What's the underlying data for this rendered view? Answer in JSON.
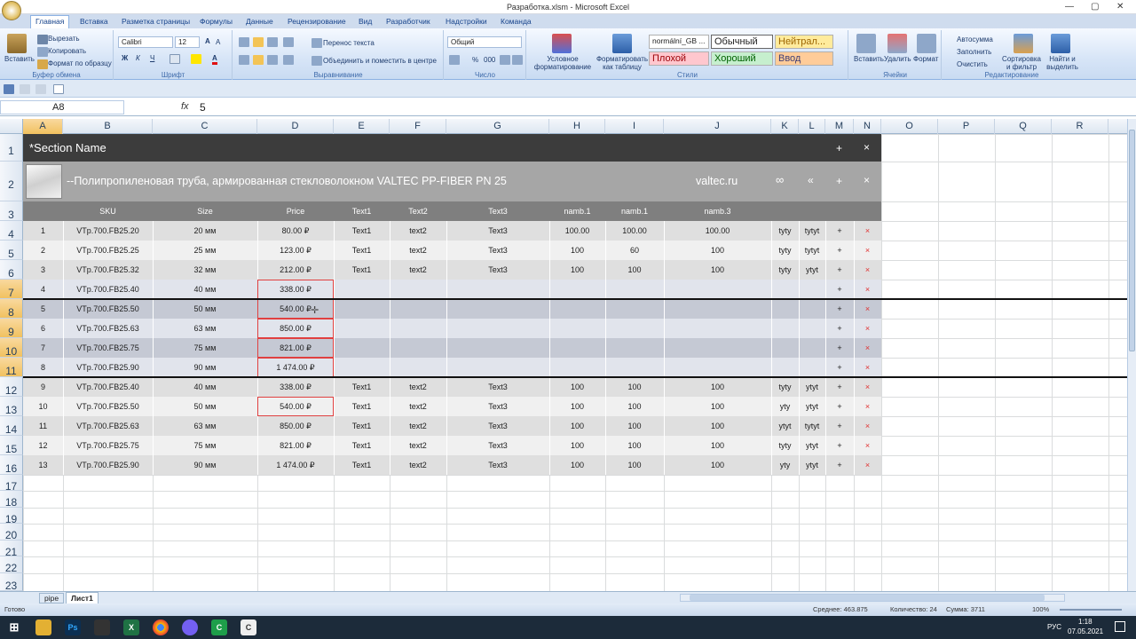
{
  "window": {
    "title": "Разработка.xlsm - Microsoft Excel"
  },
  "tabs": [
    "Главная",
    "Вставка",
    "Разметка страницы",
    "Формулы",
    "Данные",
    "Рецензирование",
    "Вид",
    "Разработчик",
    "Надстройки",
    "Команда"
  ],
  "ribbon": {
    "clipboard": {
      "paste": "Вставить",
      "cut": "Вырезать",
      "copy": "Копировать",
      "format_painter": "Формат по образцу",
      "label": "Буфер обмена"
    },
    "font": {
      "name": "Calibri",
      "size": "12",
      "label": "Шрифт",
      "bold": "Ж",
      "italic": "К",
      "underline": "Ч",
      "color_a": "A"
    },
    "alignment": {
      "wrap": "Перенос текста",
      "merge": "Объединить и поместить в центре",
      "label": "Выравнивание"
    },
    "number": {
      "format": "Общий",
      "label": "Число",
      "percent": "%",
      "thousands": "000"
    },
    "styles": {
      "cond": "Условное форматирование",
      "table": "Форматировать как таблицу",
      "cells": [
        "normální_GB ...",
        "Обычный",
        "Нейтрал...",
        "Плохой",
        "Хороший",
        "Ввод"
      ],
      "label": "Стили"
    },
    "cells": {
      "insert": "Вставить",
      "delete": "Удалить",
      "format": "Формат",
      "label": "Ячейки"
    },
    "editing": {
      "autosum": "Автосумма",
      "fill": "Заполнить",
      "clear": "Очистить",
      "sort": "Сортировка и фильтр",
      "find": "Найти и выделить",
      "label": "Редактирование"
    }
  },
  "formula_bar": {
    "name_box": "A8",
    "fx": "fx",
    "value": "5"
  },
  "columns": [
    "A",
    "B",
    "C",
    "D",
    "E",
    "F",
    "G",
    "H",
    "I",
    "J",
    "K",
    "L",
    "M",
    "N",
    "O",
    "P",
    "Q",
    "R"
  ],
  "row_numbers": [
    "1",
    "2",
    "3",
    "4",
    "5",
    "6",
    "7",
    "8",
    "9",
    "10",
    "11",
    "12",
    "13",
    "14",
    "15",
    "16",
    "17",
    "18",
    "19",
    "20",
    "21",
    "22",
    "23"
  ],
  "section": {
    "name": "*Section Name",
    "plus": "+",
    "close": "×"
  },
  "product": {
    "title": "--Полипропиленовая труба, армированная стекловолокном VALTEC PP-FIBER PN 25",
    "brand": "valtec.ru",
    "link": "∞",
    "collapse": "«",
    "plus": "+",
    "close": "×"
  },
  "table_header": [
    "SKU",
    "Size",
    "Price",
    "Text1",
    "Text2",
    "Text3",
    "namb.1",
    "namb.1",
    "namb.3"
  ],
  "rows": [
    {
      "n": "1",
      "sku": "VTp.700.FB25.20",
      "size": "20 мм",
      "price": "80.00 ₽",
      "t1": "Text1",
      "t2": "text2",
      "t3": "Text3",
      "n1": "100.00",
      "n2": "100.00",
      "n3": "100.00",
      "k": "tyty",
      "l": "tytyt",
      "plus": "+",
      "x": "×"
    },
    {
      "n": "2",
      "sku": "VTp.700.FB25.25",
      "size": "25 мм",
      "price": "123.00 ₽",
      "t1": "Text1",
      "t2": "text2",
      "t3": "Text3",
      "n1": "100",
      "n2": "60",
      "n3": "100",
      "k": "tyty",
      "l": "tytyt",
      "plus": "+",
      "x": "×"
    },
    {
      "n": "3",
      "sku": "VTp.700.FB25.32",
      "size": "32 мм",
      "price": "212.00 ₽",
      "t1": "Text1",
      "t2": "text2",
      "t3": "Text3",
      "n1": "100",
      "n2": "100",
      "n3": "100",
      "k": "tyty",
      "l": "ytyt",
      "plus": "+",
      "x": "×"
    },
    {
      "n": "4",
      "sku": "VTp.700.FB25.40",
      "size": "40 мм",
      "price": "338.00 ₽",
      "t1": "",
      "t2": "",
      "t3": "",
      "n1": "",
      "n2": "",
      "n3": "",
      "k": "",
      "l": "",
      "plus": "+",
      "x": "×"
    },
    {
      "n": "5",
      "sku": "VTp.700.FB25.50",
      "size": "50 мм",
      "price": "540.00 ₽",
      "t1": "",
      "t2": "",
      "t3": "",
      "n1": "",
      "n2": "",
      "n3": "",
      "k": "",
      "l": "",
      "plus": "+",
      "x": "×"
    },
    {
      "n": "6",
      "sku": "VTp.700.FB25.63",
      "size": "63 мм",
      "price": "850.00 ₽",
      "t1": "",
      "t2": "",
      "t3": "",
      "n1": "",
      "n2": "",
      "n3": "",
      "k": "",
      "l": "",
      "plus": "+",
      "x": "×"
    },
    {
      "n": "7",
      "sku": "VTp.700.FB25.75",
      "size": "75 мм",
      "price": "821.00 ₽",
      "t1": "",
      "t2": "",
      "t3": "",
      "n1": "",
      "n2": "",
      "n3": "",
      "k": "",
      "l": "",
      "plus": "+",
      "x": "×"
    },
    {
      "n": "8",
      "sku": "VTp.700.FB25.90",
      "size": "90 мм",
      "price": "1 474.00 ₽",
      "t1": "",
      "t2": "",
      "t3": "",
      "n1": "",
      "n2": "",
      "n3": "",
      "k": "",
      "l": "",
      "plus": "+",
      "x": "×"
    },
    {
      "n": "9",
      "sku": "VTp.700.FB25.40",
      "size": "40 мм",
      "price": "338.00 ₽",
      "t1": "Text1",
      "t2": "text2",
      "t3": "Text3",
      "n1": "100",
      "n2": "100",
      "n3": "100",
      "k": "tyty",
      "l": "ytyt",
      "plus": "+",
      "x": "×"
    },
    {
      "n": "10",
      "sku": "VTp.700.FB25.50",
      "size": "50 мм",
      "price": "540.00 ₽",
      "t1": "Text1",
      "t2": "text2",
      "t3": "Text3",
      "n1": "100",
      "n2": "100",
      "n3": "100",
      "k": "yty",
      "l": "ytyt",
      "plus": "+",
      "x": "×"
    },
    {
      "n": "11",
      "sku": "VTp.700.FB25.63",
      "size": "63 мм",
      "price": "850.00 ₽",
      "t1": "Text1",
      "t2": "text2",
      "t3": "Text3",
      "n1": "100",
      "n2": "100",
      "n3": "100",
      "k": "ytyt",
      "l": "tytyt",
      "plus": "+",
      "x": "×"
    },
    {
      "n": "12",
      "sku": "VTp.700.FB25.75",
      "size": "75 мм",
      "price": "821.00 ₽",
      "t1": "Text1",
      "t2": "text2",
      "t3": "Text3",
      "n1": "100",
      "n2": "100",
      "n3": "100",
      "k": "tyty",
      "l": "ytyt",
      "plus": "+",
      "x": "×"
    },
    {
      "n": "13",
      "sku": "VTp.700.FB25.90",
      "size": "90 мм",
      "price": "1 474.00 ₽",
      "t1": "Text1",
      "t2": "text2",
      "t3": "Text3",
      "n1": "100",
      "n2": "100",
      "n3": "100",
      "k": "yty",
      "l": "ytyt",
      "plus": "+",
      "x": "×"
    }
  ],
  "sheets": [
    "pipe",
    "Лист1"
  ],
  "status": {
    "ready": "Готово",
    "average": "Среднее: 463.875",
    "count": "Количество: 24",
    "sum": "Сумма: 3711",
    "zoom": "100%"
  },
  "taskbar": {
    "lang": "РУС",
    "time": "1:18",
    "date": "07.05.2021"
  },
  "colors": {
    "header_dark": "#3c3c3c",
    "product_bg": "#a6a6a6",
    "table_hdr": "#7f7f7f",
    "selected_red": "#e04040"
  }
}
